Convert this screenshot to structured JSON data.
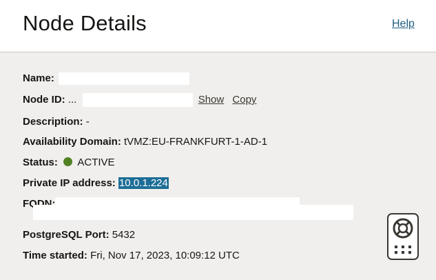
{
  "header": {
    "title": "Node Details",
    "help_link": "Help"
  },
  "details": {
    "name_label": "Name:",
    "node_id_label": "Node ID:",
    "node_id_value": "...",
    "show_link": "Show",
    "copy_link": "Copy",
    "description_label": "Description:",
    "description_value": "-",
    "availability_domain_label": "Availability Domain:",
    "availability_domain_value": "tVMZ:EU-FRANKFURT-1-AD-1",
    "status_label": "Status:",
    "status_value": "ACTIVE",
    "status_color": "#508223",
    "private_ip_label": "Private IP address:",
    "private_ip_value": "10.0.1.224",
    "fqdn_label": "FQDN:",
    "postgresql_port_label": "PostgreSQL Port:",
    "postgresql_port_value": "5432",
    "time_started_label": "Time started:",
    "time_started_value": "Fri, Nov 17, 2023, 10:09:12 UTC"
  },
  "colors": {
    "header_bg": "#ffffff",
    "page_bg": "#f1efed",
    "link": "#1f5b80",
    "selection": "#1d6e97"
  },
  "widget": {
    "icon": "lifebuoy-icon",
    "secondary_icon": "grid-dots-icon"
  }
}
